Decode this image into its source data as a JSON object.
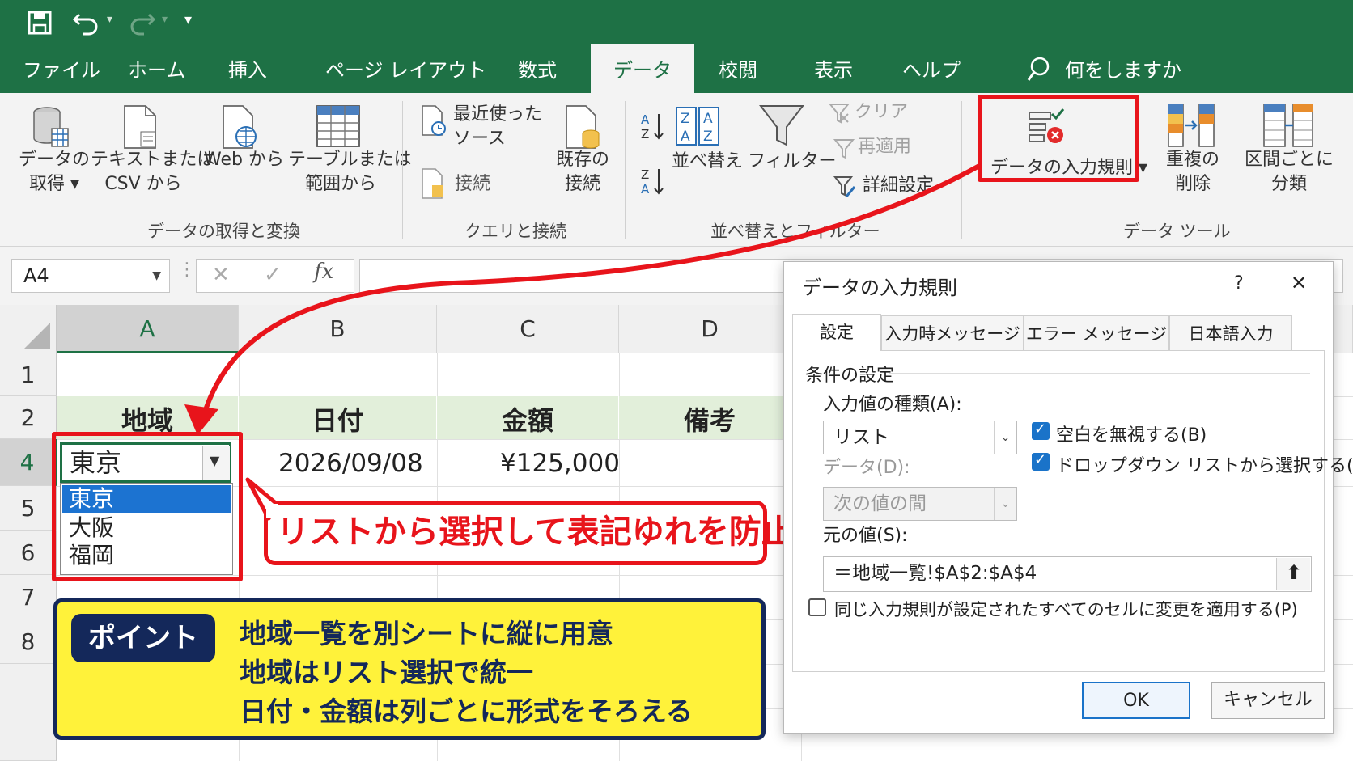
{
  "ribbon_tabs": [
    "ファイル",
    "ホーム",
    "挿入",
    "ページ レイアウト",
    "数式",
    "データ",
    "校閲",
    "表示",
    "ヘルプ"
  ],
  "tell_me": "何をしますか",
  "ribbon": {
    "get_data": [
      "データの",
      "取得 ▾"
    ],
    "text_csv": [
      "テキストまたは",
      "CSV から"
    ],
    "web": [
      "Web から"
    ],
    "table_range": [
      "テーブルまたは",
      "範囲から"
    ],
    "recent_sources": [
      "最近使った",
      "ソース"
    ],
    "connections": "接続",
    "existing": [
      "既存の",
      "接続"
    ],
    "sort": "並べ替え",
    "filter": "フィルター",
    "clear": "クリア",
    "reapply": "再適用",
    "advanced": "詳細設定",
    "validation": "データの入力規則 ▾",
    "remove_dup": [
      "重複の",
      "削除"
    ],
    "split": [
      "区間ごとに",
      "分類"
    ],
    "group_get": "データの取得と変換",
    "group_query": "クエリと接続",
    "group_sort": "並べ替えとフィルター",
    "group_tools": "データ ツール"
  },
  "formula_bar": {
    "name_box": "A4",
    "fx": "fx"
  },
  "sheet": {
    "columns": [
      "A",
      "B",
      "C",
      "D"
    ],
    "rows": [
      "1",
      "2",
      "4",
      "5",
      "6",
      "7",
      "8"
    ],
    "headers": [
      "地域",
      "日付",
      "金額",
      "備考"
    ],
    "row4": {
      "region": "東京",
      "date": "2026/09/08",
      "amount": "¥125,000"
    },
    "dropdown": [
      "東京",
      "大阪",
      "福岡"
    ]
  },
  "callout": "リストから選択して表記ゆれを防止",
  "point": {
    "badge": "ポイント",
    "lines": [
      "地域一覧を別シートに縦に用意",
      "地域はリスト選択で統一",
      "日付・金額は列ごとに形式をそろえる"
    ]
  },
  "dialog": {
    "title": "データの入力規則",
    "help": "?",
    "close": "✕",
    "tabs": [
      "設定",
      "入力時メッセージ",
      "エラー メッセージ",
      "日本語入力"
    ],
    "section": "条件の設定",
    "allow_label": "入力値の種類(A):",
    "allow_value": "リスト",
    "data_label": "データ(D):",
    "data_value": "次の値の間",
    "ignore_blank": "空白を無視する(B)",
    "in_cell_dropdown": "ドロップダウン リストから選択する(I)",
    "source_label": "元の値(S):",
    "source_value": "＝地域一覧!$A$2:$A$4",
    "apply_all": "同じ入力規則が設定されたすべてのセルに変更を適用する(P)",
    "ok": "OK",
    "cancel": "キャンセル"
  },
  "colors": {
    "excel_green": "#1e7145",
    "highlight_red": "#e8141b",
    "point_yellow": "#fff23a",
    "point_navy": "#14285a",
    "check_blue": "#1a73c9"
  }
}
